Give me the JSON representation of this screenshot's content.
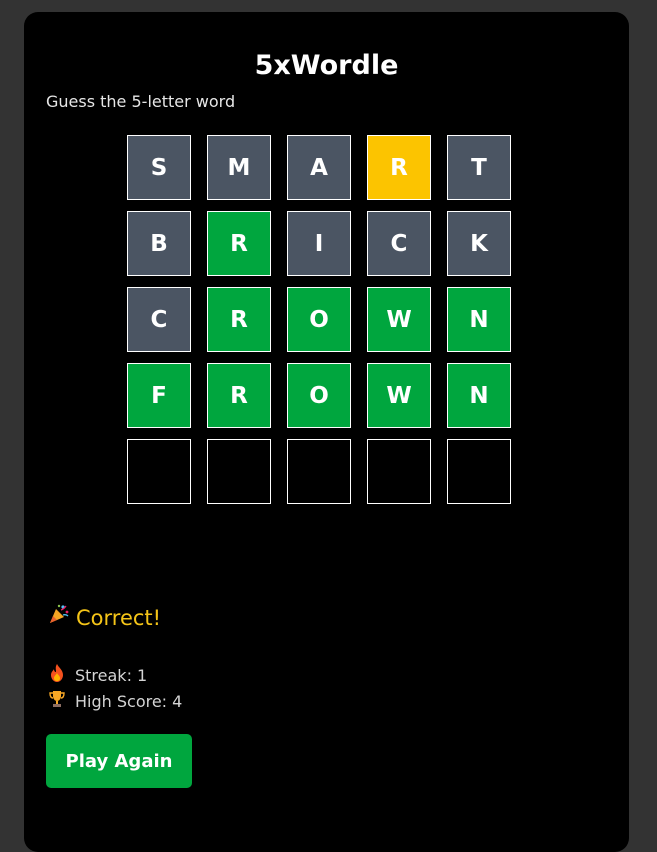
{
  "game": {
    "title": "5xWordle",
    "subtitle": "Guess the 5-letter word"
  },
  "colors": {
    "gray": "#4b5563",
    "green": "#00a63e",
    "yellow": "#fcc400",
    "empty": "#000000"
  },
  "board": {
    "rows": [
      [
        {
          "letter": "S",
          "state": "gray"
        },
        {
          "letter": "M",
          "state": "gray"
        },
        {
          "letter": "A",
          "state": "gray"
        },
        {
          "letter": "R",
          "state": "yellow"
        },
        {
          "letter": "T",
          "state": "gray"
        }
      ],
      [
        {
          "letter": "B",
          "state": "gray"
        },
        {
          "letter": "R",
          "state": "green"
        },
        {
          "letter": "I",
          "state": "gray"
        },
        {
          "letter": "C",
          "state": "gray"
        },
        {
          "letter": "K",
          "state": "gray"
        }
      ],
      [
        {
          "letter": "C",
          "state": "gray"
        },
        {
          "letter": "R",
          "state": "green"
        },
        {
          "letter": "O",
          "state": "green"
        },
        {
          "letter": "W",
          "state": "green"
        },
        {
          "letter": "N",
          "state": "green"
        }
      ],
      [
        {
          "letter": "F",
          "state": "green"
        },
        {
          "letter": "R",
          "state": "green"
        },
        {
          "letter": "O",
          "state": "green"
        },
        {
          "letter": "W",
          "state": "green"
        },
        {
          "letter": "N",
          "state": "green"
        }
      ],
      [
        {
          "letter": "",
          "state": "empty"
        },
        {
          "letter": "",
          "state": "empty"
        },
        {
          "letter": "",
          "state": "empty"
        },
        {
          "letter": "",
          "state": "empty"
        },
        {
          "letter": "",
          "state": "empty"
        }
      ]
    ]
  },
  "status": {
    "icon": "party-popper-icon",
    "text": "Correct!"
  },
  "stats": {
    "streak_icon": "fire-icon",
    "streak_text": "Streak: 1",
    "high_icon": "trophy-icon",
    "high_text": "High Score: 4"
  },
  "actions": {
    "play_again_label": "Play Again"
  }
}
